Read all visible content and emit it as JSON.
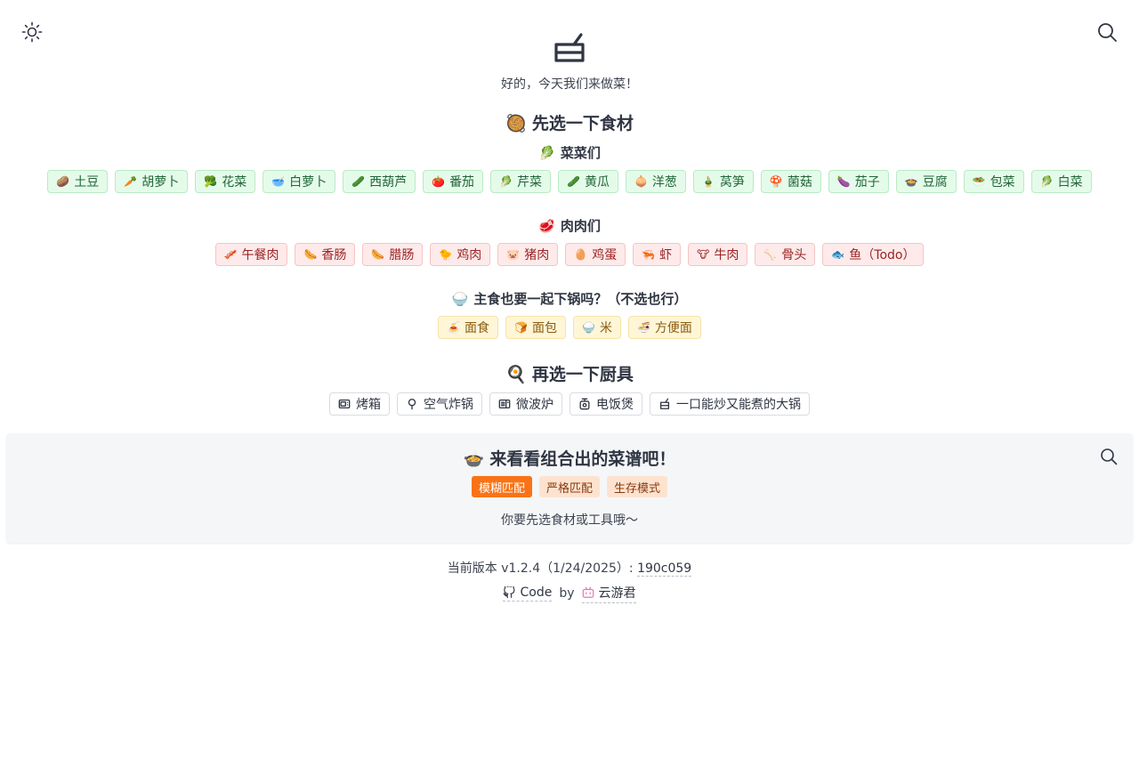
{
  "header": {
    "theme_icon": "sun-icon",
    "search_icon": "search-icon",
    "logo_icon": "pot-icon",
    "subtitle": "好的，今天我们来做菜！"
  },
  "ingredients": {
    "title_emoji": "🥘",
    "title": "先选一下食材",
    "vegetables": {
      "emoji": "🥬",
      "title": "菜菜们",
      "items": [
        {
          "emoji": "🥔",
          "label": "土豆"
        },
        {
          "emoji": "🥕",
          "label": "胡萝卜"
        },
        {
          "emoji": "🥦",
          "label": "花菜"
        },
        {
          "emoji": "🥣",
          "label": "白萝卜"
        },
        {
          "emoji": "🥒",
          "label": "西葫芦"
        },
        {
          "emoji": "🍅",
          "label": "番茄"
        },
        {
          "emoji": "🥬",
          "label": "芹菜"
        },
        {
          "emoji": "🥒",
          "label": "黄瓜"
        },
        {
          "emoji": "🧅",
          "label": "洋葱"
        },
        {
          "emoji": "🎍",
          "label": "莴笋"
        },
        {
          "emoji": "🍄",
          "label": "菌菇"
        },
        {
          "emoji": "🍆",
          "label": "茄子"
        },
        {
          "emoji": "🍲",
          "label": "豆腐"
        },
        {
          "emoji": "🥗",
          "label": "包菜"
        },
        {
          "emoji": "🥬",
          "label": "白菜"
        }
      ]
    },
    "meats": {
      "emoji": "🥩",
      "title": "肉肉们",
      "items": [
        {
          "emoji": "🥓",
          "label": "午餐肉"
        },
        {
          "emoji": "🌭",
          "label": "香肠"
        },
        {
          "emoji": "🌭",
          "label": "腊肠"
        },
        {
          "emoji": "🐤",
          "label": "鸡肉"
        },
        {
          "emoji": "🐷",
          "label": "猪肉"
        },
        {
          "emoji": "🥚",
          "label": "鸡蛋"
        },
        {
          "emoji": "🦐",
          "label": "虾"
        },
        {
          "emoji": "🐮",
          "label": "牛肉"
        },
        {
          "emoji": "🦴",
          "label": "骨头"
        },
        {
          "emoji": "🐟",
          "label": "鱼（Todo）"
        }
      ]
    },
    "staples": {
      "emoji": "🍚",
      "title": "主食也要一起下锅吗？（不选也行）",
      "items": [
        {
          "emoji": "🍝",
          "label": "面食"
        },
        {
          "emoji": "🍞",
          "label": "面包"
        },
        {
          "emoji": "🍚",
          "label": "米"
        },
        {
          "emoji": "🍜",
          "label": "方便面"
        }
      ]
    }
  },
  "tools": {
    "title_emoji": "🍳",
    "title": "再选一下厨具",
    "items": [
      {
        "icon": "oven-icon",
        "label": "烤箱"
      },
      {
        "icon": "air-fryer-icon",
        "label": "空气炸锅"
      },
      {
        "icon": "microwave-icon",
        "label": "微波炉"
      },
      {
        "icon": "rice-cooker-icon",
        "label": "电饭煲"
      },
      {
        "icon": "pot-icon",
        "label": "一口能炒又能煮的大锅"
      }
    ]
  },
  "recipes": {
    "title_emoji": "🍲",
    "title": "来看看组合出的菜谱吧！",
    "search_icon": "search-icon",
    "modes": [
      {
        "label": "模糊匹配",
        "active": true
      },
      {
        "label": "严格匹配",
        "active": false
      },
      {
        "label": "生存模式",
        "active": false
      }
    ],
    "hint": "你要先选食材或工具哦～"
  },
  "footer": {
    "version_prefix": "当前版本 v1.2.4（1/24/2025）: ",
    "commit": "190c059",
    "code_label": "Code",
    "by": "by",
    "author": "云游君"
  }
}
